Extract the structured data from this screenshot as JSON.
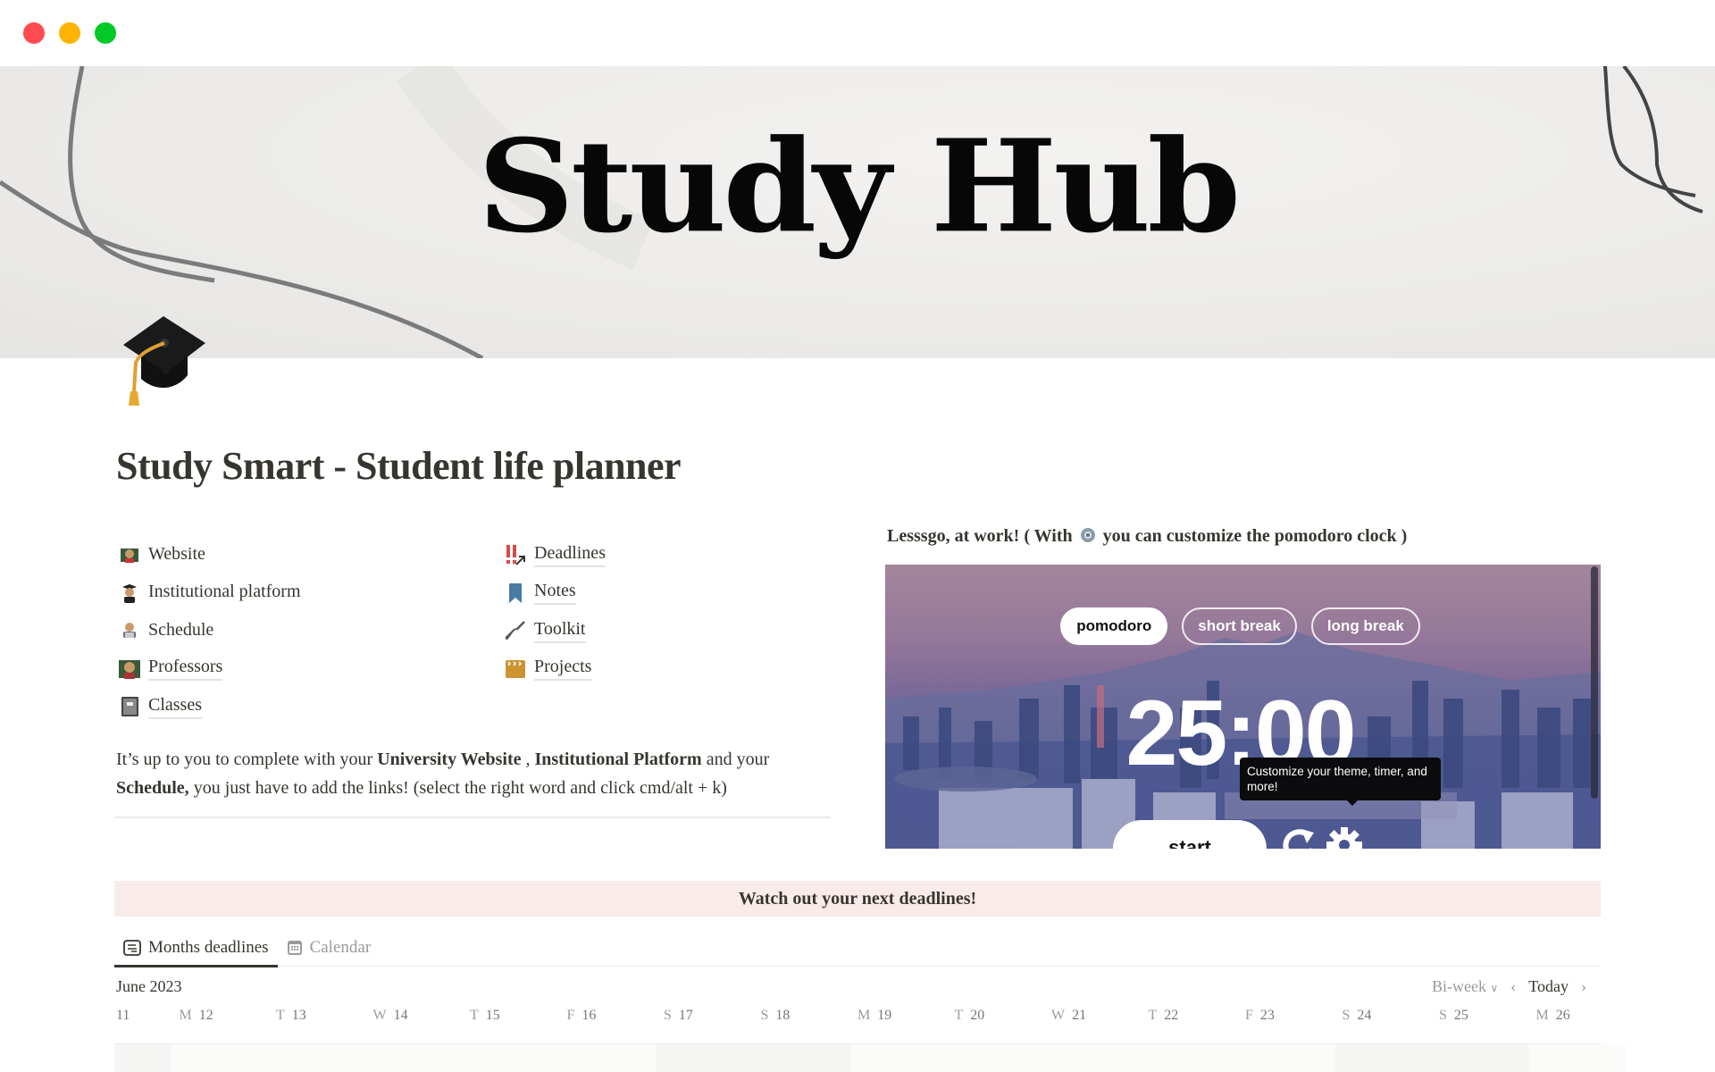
{
  "window": {
    "controls": [
      "close",
      "minimize",
      "maximize"
    ],
    "colors": {
      "close": "#ff4b50",
      "minimize": "#ffb404",
      "maximize": "#00c925"
    }
  },
  "cover": {
    "title": "Study Hub"
  },
  "page": {
    "icon": "graduation-cap-icon",
    "title": "Study Smart - Student life planner"
  },
  "links": {
    "left": [
      {
        "label": "Website",
        "icon": "teacher-icon"
      },
      {
        "label": "Institutional platform",
        "icon": "graduate-icon"
      },
      {
        "label": "Schedule",
        "icon": "technologist-icon"
      },
      {
        "label": "Professors",
        "icon": "teacher-icon"
      },
      {
        "label": "Classes",
        "icon": "notebook-icon"
      }
    ],
    "right": [
      {
        "label": "Deadlines",
        "icon": "double-exclamation-icon"
      },
      {
        "label": "Notes",
        "icon": "bookmark-icon"
      },
      {
        "label": "Toolkit",
        "icon": "screwdriver-icon"
      },
      {
        "label": "Projects",
        "icon": "clapperboard-icon"
      }
    ]
  },
  "intro": {
    "p1": "It’s up to you to complete with your ",
    "b1": "University Website",
    "p2": " , ",
    "b2": "Institutional Platform",
    "p3": " and your ",
    "b3": "Schedule,",
    "p4": " you just have to add the links! (select the right word and click cmd/alt + k)"
  },
  "pomodoro": {
    "caption_before": "Lesssgo, at work! ( With ",
    "caption_after": " you can customize the pomodoro clock )",
    "tabs": [
      {
        "label": "pomodoro",
        "active": true
      },
      {
        "label": "short break",
        "active": false
      },
      {
        "label": "long break",
        "active": false
      }
    ],
    "time": "25:00",
    "start_label": "start",
    "tooltip": "Customize your theme, timer, and more!"
  },
  "callout": {
    "text": "Watch out your next deadlines!",
    "bg": "#faebeb"
  },
  "views": {
    "tabs": [
      {
        "label": "Months deadlines",
        "icon": "list-view-icon",
        "active": true
      },
      {
        "label": "Calendar",
        "icon": "calendar-icon",
        "active": false
      }
    ]
  },
  "calendar": {
    "month": "June 2023",
    "range": "Bi-week",
    "today_label": "Today",
    "days": [
      {
        "dow": "",
        "num": "11"
      },
      {
        "dow": "M",
        "num": "12"
      },
      {
        "dow": "T",
        "num": "13"
      },
      {
        "dow": "W",
        "num": "14"
      },
      {
        "dow": "T",
        "num": "15"
      },
      {
        "dow": "F",
        "num": "16"
      },
      {
        "dow": "S",
        "num": "17"
      },
      {
        "dow": "S",
        "num": "18"
      },
      {
        "dow": "M",
        "num": "19"
      },
      {
        "dow": "T",
        "num": "20"
      },
      {
        "dow": "W",
        "num": "21"
      },
      {
        "dow": "T",
        "num": "22"
      },
      {
        "dow": "F",
        "num": "23"
      },
      {
        "dow": "S",
        "num": "24"
      },
      {
        "dow": "S",
        "num": "25"
      },
      {
        "dow": "M",
        "num": "26"
      }
    ]
  }
}
